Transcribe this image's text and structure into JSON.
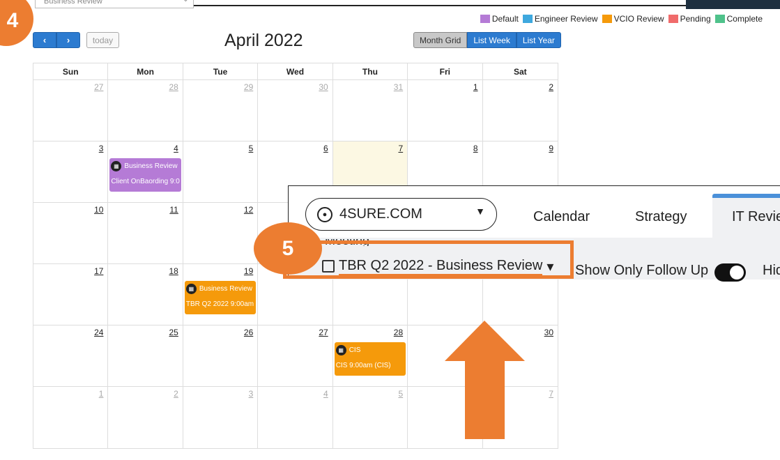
{
  "top": {
    "dropdown_value": "Business Review",
    "dropdown_chevron": "⌄"
  },
  "badges": {
    "step4": "4",
    "step5": "5"
  },
  "legend": [
    {
      "label": "Default",
      "color": "#b57bd6"
    },
    {
      "label": "Engineer Review",
      "color": "#3ea8de"
    },
    {
      "label": "VCIO Review",
      "color": "#f59a0b"
    },
    {
      "label": "Pending",
      "color": "#f06b6b"
    },
    {
      "label": "Complete",
      "color": "#4fc28b"
    }
  ],
  "toolbar": {
    "prev": "‹",
    "next": "›",
    "today": "today",
    "title": "April 2022",
    "views": [
      "Month Grid",
      "List Week",
      "List Year"
    ]
  },
  "weekdays": [
    "Sun",
    "Mon",
    "Tue",
    "Wed",
    "Thu",
    "Fri",
    "Sat"
  ],
  "weeks": [
    [
      "27",
      "28",
      "29",
      "30",
      "31",
      "1",
      "2"
    ],
    [
      "3",
      "4",
      "5",
      "6",
      "7",
      "8",
      "9"
    ],
    [
      "10",
      "11",
      "12",
      "",
      "",
      "",
      ""
    ],
    [
      "17",
      "18",
      "19",
      "",
      "",
      "",
      ""
    ],
    [
      "24",
      "25",
      "26",
      "27",
      "28",
      "",
      "30"
    ],
    [
      "1",
      "2",
      "3",
      "4",
      "5",
      "",
      "7"
    ]
  ],
  "events": {
    "e1": {
      "title": "Business Review",
      "detail": "Client OnBaording 9:0",
      "color": "#b57bd6"
    },
    "e2": {
      "title": "Business Review",
      "detail": "TBR Q2 2022 9:00am",
      "color": "#f59a0b"
    },
    "e3": {
      "title": "CIS",
      "detail": "CIS 9:00am (CIS)",
      "color": "#f59a0b"
    }
  },
  "overlay": {
    "client": "4SURE.COM",
    "tabs": [
      "Calendar",
      "Strategy",
      "IT Revie"
    ],
    "meeting_label": "Meeting",
    "meeting_value": "TBR Q2 2022 - Business Review",
    "meeting_chevron": "▾",
    "follow_label": "Show Only Follow Up",
    "follow_on": true,
    "hide_label": "Hid"
  }
}
